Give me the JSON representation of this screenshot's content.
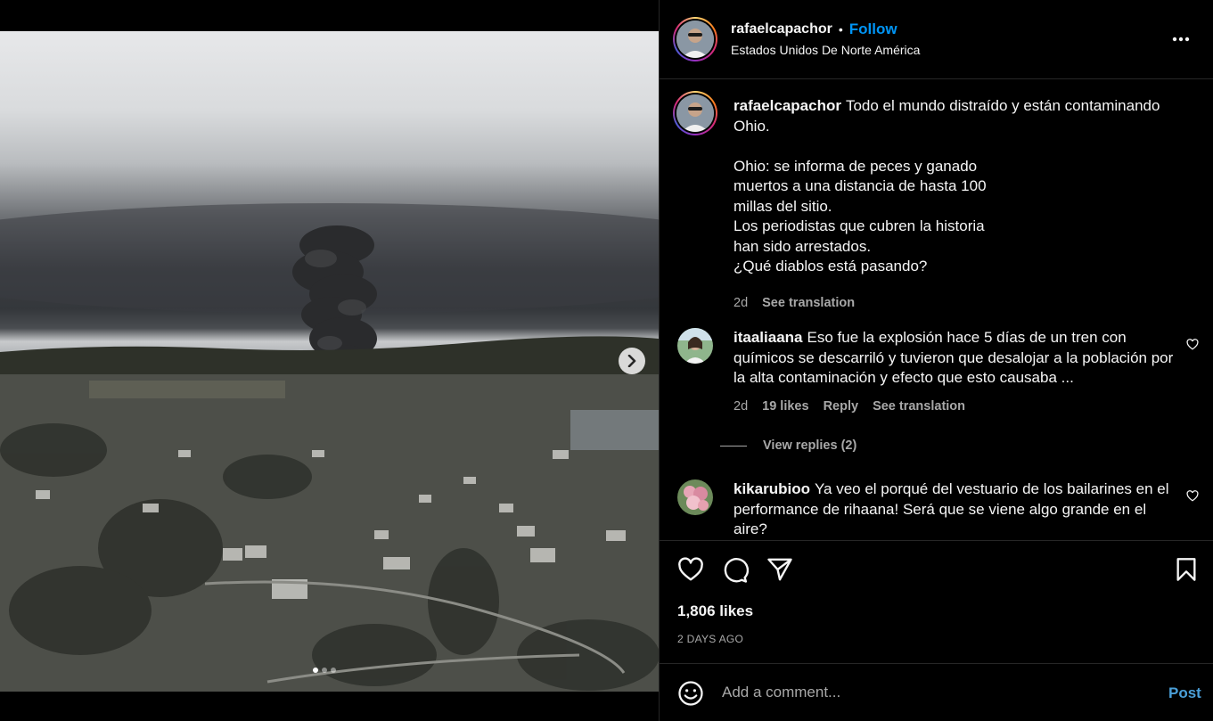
{
  "post": {
    "author": "rafaelcapachor",
    "separator": "•",
    "follow_label": "Follow",
    "location": "Estados Unidos De Norte América",
    "more_label": "•••",
    "carousel": {
      "slide_count": 3,
      "active_index": 0
    }
  },
  "caption": {
    "username": "rafaelcapachor",
    "text": "Todo el mundo distraído y están contaminando Ohio.\n\nOhio: se informa de peces y ganado\nmuertos a una distancia de hasta 100\nmillas del sitio.\nLos periodistas que cubren la historia\nhan sido arrestados.\n¿Qué diablos está pasando?",
    "time": "2d",
    "see_translation": "See translation"
  },
  "comments": [
    {
      "username": "itaaliaana",
      "text": "Eso fue la explosión hace 5 días de un tren con químicos se descarriló y tuvieron que desalojar a la población por la alta contaminación y efecto que esto causaba ...",
      "time": "2d",
      "likes": "19 likes",
      "reply": "Reply",
      "see_translation": "See translation",
      "view_replies": "View replies (2)"
    },
    {
      "username": "kikarubioo",
      "text": "Ya veo el porqué del vestuario de los bailarines en el performance de rihaana! Será que se viene algo grande en el aire?"
    }
  ],
  "actions": {
    "likes": "1,806 likes",
    "date": "2 DAYS AGO"
  },
  "add_comment": {
    "placeholder": "Add a comment...",
    "post_label": "Post"
  },
  "colors": {
    "accent": "#0095f6",
    "post_button": "#4a9fd8",
    "secondary_text": "#a8a8a8",
    "divider": "#262626"
  },
  "icons": [
    "chevron-right-icon",
    "more-icon",
    "heart-icon",
    "comment-icon",
    "share-icon",
    "bookmark-icon",
    "emoji-icon"
  ]
}
